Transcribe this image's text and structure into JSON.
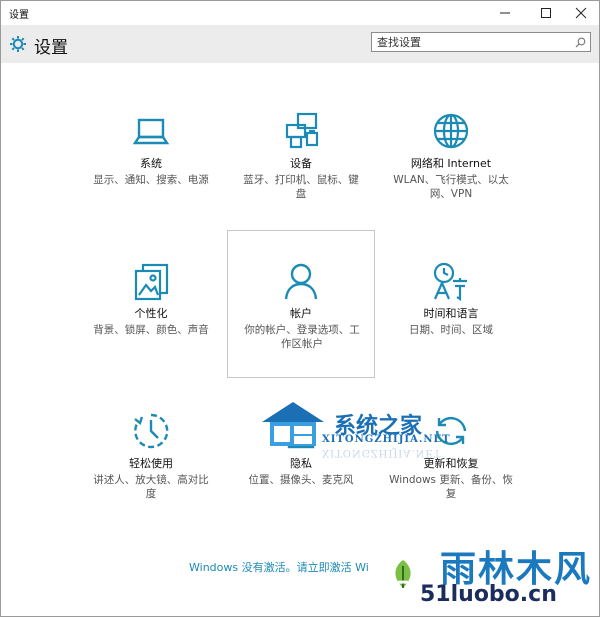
{
  "window": {
    "title": "设置"
  },
  "header": {
    "title": "设置",
    "search_placeholder": "查找设置"
  },
  "tiles": [
    {
      "name": "系统",
      "desc": "显示、通知、搜索、电源",
      "icon": "laptop-icon"
    },
    {
      "name": "设备",
      "desc": "蓝牙、打印机、鼠标、键盘",
      "icon": "devices-icon"
    },
    {
      "name": "网络和 Internet",
      "desc": "WLAN、飞行模式、以太网、VPN",
      "icon": "globe-icon"
    },
    {
      "name": "个性化",
      "desc": "背景、锁屏、颜色、声音",
      "icon": "personalization-icon"
    },
    {
      "name": "帐户",
      "desc": "你的帐户、登录选项、工作区帐户",
      "icon": "person-icon"
    },
    {
      "name": "时间和语言",
      "desc": "日期、时间、区域",
      "icon": "time-language-icon"
    },
    {
      "name": "轻松使用",
      "desc": "讲述人、放大镜、高对比度",
      "icon": "ease-of-access-icon"
    },
    {
      "name": "隐私",
      "desc": "位置、摄像头、麦克风",
      "icon": "lock-icon"
    },
    {
      "name": "更新和恢复",
      "desc": "Windows 更新、备份、恢复",
      "icon": "update-icon"
    }
  ],
  "activation_link": "Windows 没有激活。请立即激活 Wi",
  "watermarks": {
    "site1_title": "系统之家",
    "site1_url": "XITONGZHIJIA.NET",
    "site2_title": "雨林木风",
    "site2_url": "51luobo.cn"
  },
  "colors": {
    "accent": "#1b8bb5",
    "header_band": "#ececec"
  }
}
